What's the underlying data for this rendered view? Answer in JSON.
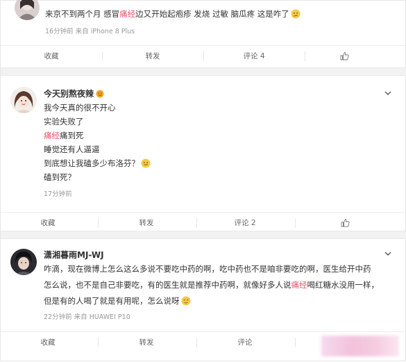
{
  "post1": {
    "text_pre": "来京不到两个月 感冒",
    "text_hl": "痛经",
    "text_post": "边又开始起疱疹 发烧 过敏 脑瓜疼 这是咋了",
    "meta": "16分钟前  来自 iPhone 8 Plus",
    "actions": {
      "fav": "收藏",
      "repost": "转发",
      "comment": "评论 4"
    }
  },
  "post2": {
    "username": "今天别熬夜辣",
    "lines": [
      "我今天真的很不开心",
      "实验失败了"
    ],
    "hl_word": "痛经",
    "hl_rest": "痛到死",
    "lines2": [
      "睡觉还有人逼逼",
      "到底想让我磕多少布洛芬？"
    ],
    "last_line": "磕到死？",
    "meta": "17分钟前",
    "actions": {
      "fav": "收藏",
      "repost": "转发",
      "comment": "评论 2"
    }
  },
  "post3": {
    "username": "潇湘暮雨MJ-WJ",
    "line1": "咋滴，现在微博上怎么这么多说不要吃中药的啊，吃中药也不是咱非要吃的啊，医生给开中药",
    "line2_pre": "怎么说，也不是自己非要吃，有的医生就是推荐中药啊，就像好多人说",
    "line2_hl": "痛经",
    "line2_post": "喝红糖水没用一样，",
    "line3": "但是有的人喝了就是有用呢，怎么说呀",
    "meta": "22分钟前  来自 HUAWEI P10",
    "actions": {
      "fav": "收藏",
      "repost": "转发",
      "comment": "评论"
    }
  },
  "colors": {
    "highlight": "#e8556c",
    "meta": "#999999",
    "separator": "#f2f2f2"
  }
}
